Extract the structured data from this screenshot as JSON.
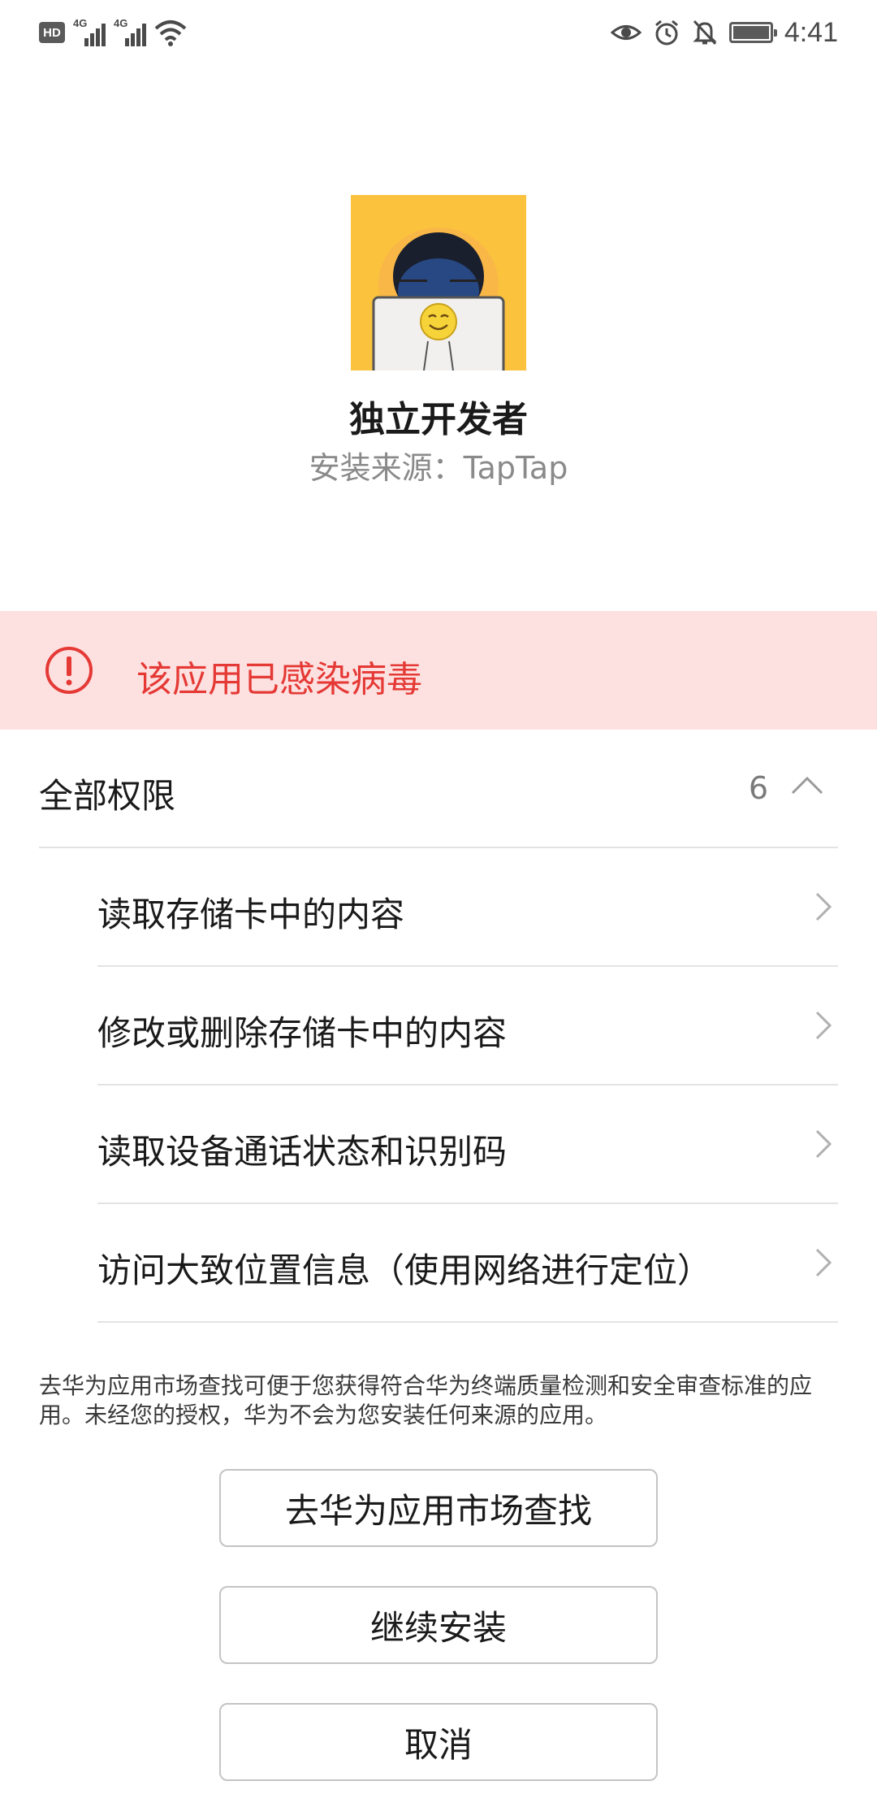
{
  "status_bar": {
    "hd_label": "HD",
    "network_1": "4G",
    "network_2": "4G",
    "time": "4:41",
    "icons": [
      "hd-icon",
      "signal-icon",
      "signal-icon",
      "wifi-icon",
      "eye-icon",
      "alarm-icon",
      "bell-off-icon",
      "battery-icon"
    ]
  },
  "app": {
    "name": "独立开发者",
    "source": "安装来源：TapTap"
  },
  "warning": {
    "text": "该应用已感染病毒",
    "color": "#e53935",
    "background": "#fde1e1"
  },
  "permissions": {
    "title": "全部权限",
    "count": "6",
    "items": [
      {
        "label": "读取存储卡中的内容"
      },
      {
        "label": "修改或删除存储卡中的内容"
      },
      {
        "label": "读取设备通话状态和识别码"
      },
      {
        "label": "访问大致位置信息（使用网络进行定位）"
      }
    ]
  },
  "notice": "去华为应用市场查找可便于您获得符合华为终端质量检测和安全审查标准的应用。未经您的授权，华为不会为您安装任何来源的应用。",
  "buttons": {
    "market": "去华为应用市场查找",
    "continue": "继续安装",
    "cancel": "取消"
  }
}
